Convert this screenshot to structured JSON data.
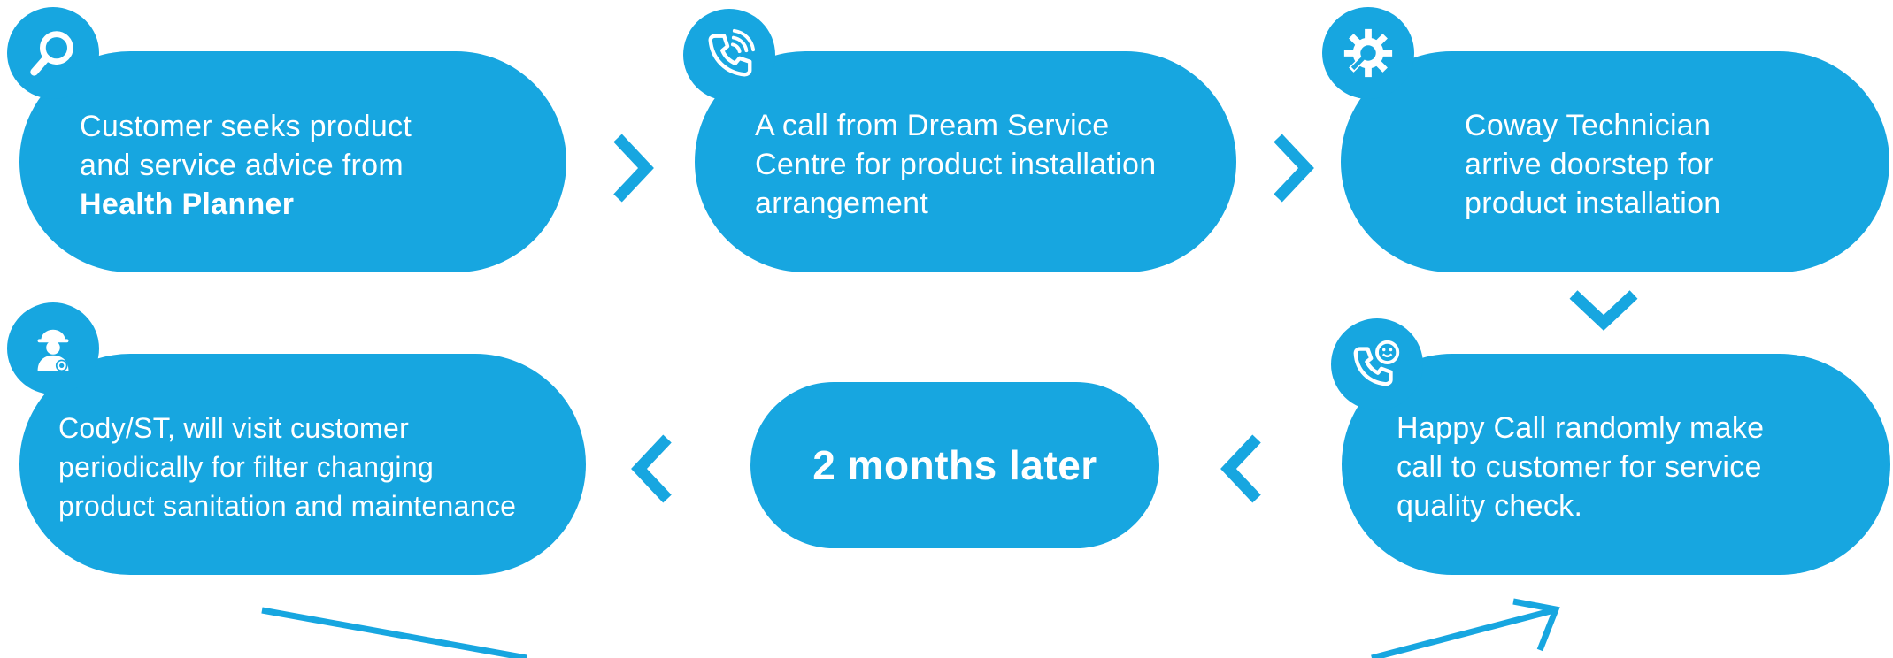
{
  "steps": {
    "step1": {
      "lines": [
        "Customer seeks product",
        "and service advice from"
      ],
      "bold": "Health Planner",
      "icon": "search-icon"
    },
    "step2": {
      "lines": [
        "A call from Dream Service",
        "Centre for product installation",
        "arrangement"
      ],
      "icon": "phone-ringing-icon"
    },
    "step3": {
      "lines": [
        "Coway Technician",
        "arrive doorstep for",
        "product installation"
      ],
      "icon": "gear-wrench-icon"
    },
    "step4": {
      "lines": [
        "Happy Call randomly make",
        "call to customer for service",
        "quality check."
      ],
      "icon": "phone-smile-icon"
    },
    "step5": {
      "label": "2 months later"
    },
    "step6": {
      "lines": [
        "Cody/ST, will visit customer",
        "periodically for filter changing",
        "product sanitation and maintenance"
      ],
      "icon": "technician-icon"
    }
  },
  "colors": {
    "primary": "#17a6e0",
    "text": "#ffffff"
  }
}
